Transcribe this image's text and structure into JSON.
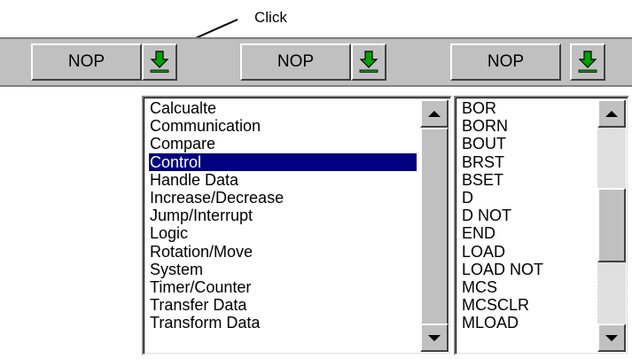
{
  "annotation": {
    "label": "Click"
  },
  "toolbar": {
    "buttons": [
      {
        "label": "NOP",
        "icon": "download-arrow-icon"
      },
      {
        "label": "NOP",
        "icon": "download-arrow-icon"
      },
      {
        "label": "NOP",
        "icon": "download-arrow-icon"
      }
    ]
  },
  "category_list": {
    "items": [
      "Calcualte",
      "Communication",
      "Compare",
      "Control",
      "Handle Data",
      "Increase/Decrease",
      "Jump/Interrupt",
      "Logic",
      "Rotation/Move",
      "System",
      "Timer/Counter",
      "Transfer Data",
      "Transform Data"
    ],
    "selected": "Control",
    "scroll_fraction": 1.0
  },
  "instruction_list": {
    "items": [
      "BOR",
      "BORN",
      "BOUT",
      "BRST",
      "BSET",
      "D",
      "D NOT",
      "END",
      "LOAD",
      "LOAD NOT",
      "MCS",
      "MCSCLR",
      "MLOAD"
    ],
    "scroll_fraction": 0.45
  },
  "colors": {
    "face": "#c0c0c0",
    "selection": "#000080",
    "icon_green": "#00a000"
  }
}
